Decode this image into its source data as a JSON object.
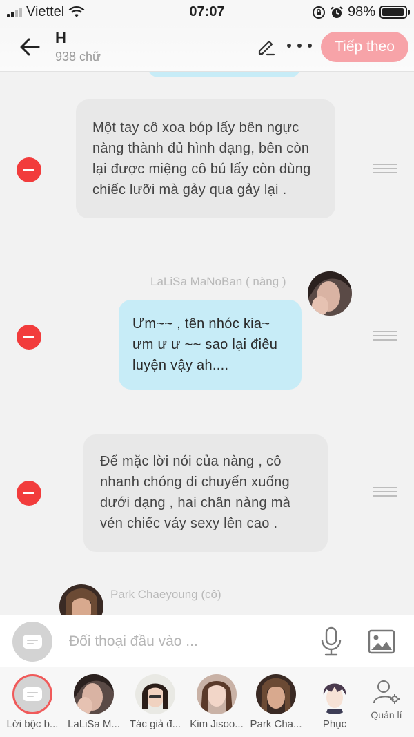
{
  "status_bar": {
    "carrier": "Viettel",
    "time": "07:07",
    "battery": "98%",
    "battery_level": 0.98
  },
  "header": {
    "title": "H",
    "word_count": "938 chữ",
    "next_label": "Tiếp theo",
    "accent": "#f7a3a8"
  },
  "messages": [
    {
      "type": "narration",
      "text": "Một tay cô xoa bóp lấy bên ngực nàng thành đủ hình dạng, bên còn lại được miệng cô bú lấy còn dùng chiếc lưỡi mà gảy qua gảy lại ."
    },
    {
      "type": "character",
      "speaker": "LaLiSa MaNoBan ( nàng )",
      "text": "Ưm~~ , tên nhóc kia~ ưm ư ư ~~ sao lại điêu luyện vậy ah...."
    },
    {
      "type": "narration",
      "text": "Để mặc lời nói của nàng , cô nhanh chóng di chuyển xuống dưới dạng , hai chân nàng mà vén chiếc váy sexy lên cao ."
    },
    {
      "type": "character",
      "speaker": "Park Chaeyoung (cô)",
      "text": ""
    }
  ],
  "input": {
    "placeholder": "Đối thoại đầu vào ..."
  },
  "characters": [
    {
      "name": "Lời bộc b...",
      "selected": true
    },
    {
      "name": "LaLiSa M...",
      "selected": false
    },
    {
      "name": "Tác giả đ...",
      "selected": false
    },
    {
      "name": "Kim Jisoo...",
      "selected": false
    },
    {
      "name": "Park Cha...",
      "selected": false
    },
    {
      "name": "Phục",
      "selected": false
    }
  ],
  "manage_label": "Quản lí",
  "colors": {
    "narration_bubble": "#e8e8e8",
    "character_bubble": "#c7ecf7",
    "remove": "#f23c3c"
  }
}
